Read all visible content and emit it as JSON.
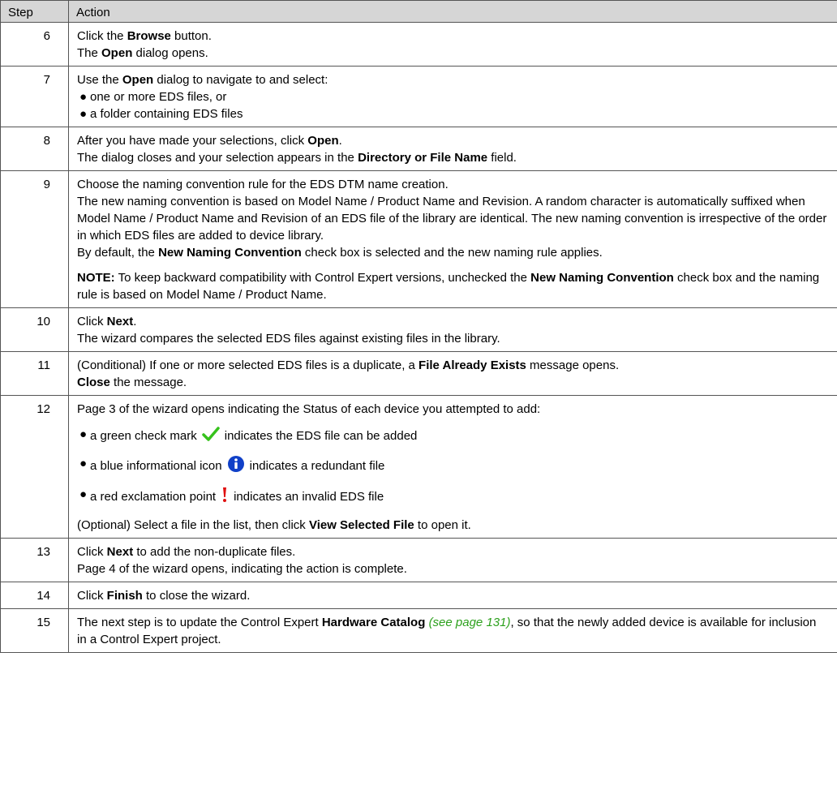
{
  "header": {
    "step": "Step",
    "action": "Action"
  },
  "rows": {
    "r6": {
      "step": "6",
      "l1a": "Click the ",
      "l1b": "Browse",
      "l1c": " button.",
      "l2a": "The ",
      "l2b": "Open",
      "l2c": " dialog opens."
    },
    "r7": {
      "step": "7",
      "l1a": "Use the ",
      "l1b": "Open",
      "l1c": " dialog to navigate to and select:",
      "b1": "one or more EDS files, or",
      "b2": "a folder containing EDS files"
    },
    "r8": {
      "step": "8",
      "l1a": "After you have made your selections, click ",
      "l1b": "Open",
      "l1c": ".",
      "l2a": "The dialog closes and your selection appears in the ",
      "l2b": "Directory or File Name",
      "l2c": " field."
    },
    "r9": {
      "step": "9",
      "l1": "Choose the naming convention rule for the EDS DTM name creation.",
      "l2": "The new naming convention is based on Model Name / Product Name and Revision. A random character is automatically suffixed when Model Name / Product Name and Revision of an EDS file of the library are identical. The new naming convention is irrespective of the order in which EDS files are added to device library.",
      "l3a": "By default, the ",
      "l3b": "New Naming Convention",
      "l3c": " check box is selected and the new naming rule applies.",
      "note_label": "NOTE:",
      "n1": " To keep backward compatibility with Control Expert versions, unchecked the ",
      "n2": "New Naming Convention",
      "n3": " check box and the naming rule is based on Model Name / Product Name."
    },
    "r10": {
      "step": "10",
      "l1a": "Click ",
      "l1b": "Next",
      "l1c": ".",
      "l2": "The wizard compares the selected EDS files against existing files in the library."
    },
    "r11": {
      "step": "11",
      "l1a": "(Conditional) If one or more selected EDS files is a duplicate, a ",
      "l1b": "File Already Exists",
      "l1c": " message opens.",
      "l2a": "Close",
      "l2b": " the message."
    },
    "r12": {
      "step": "12",
      "l1": "Page 3 of the wizard opens indicating the Status of each device you attempted to add:",
      "b1a": "a green check mark",
      "b1b": "indicates the EDS file can be added",
      "b2a": "a blue informational icon",
      "b2b": "indicates a redundant file",
      "b3a": "a red exclamation point",
      "b3b": "indicates an invalid EDS file",
      "l2a": "(Optional) Select a file in the list, then click ",
      "l2b": "View Selected File",
      "l2c": " to open it."
    },
    "r13": {
      "step": "13",
      "l1a": "Click ",
      "l1b": "Next",
      "l1c": " to add the non-duplicate files.",
      "l2": "Page 4 of the wizard opens, indicating the action is complete."
    },
    "r14": {
      "step": "14",
      "l1a": "Click ",
      "l1b": "Finish",
      "l1c": " to close the wizard."
    },
    "r15": {
      "step": "15",
      "l1a": "The next step is to update the Control Expert ",
      "l1b": "Hardware Catalog",
      "link": "(see page 131)",
      "l1c": ", so that the newly added device is available for inclusion in a Control Expert project."
    }
  },
  "bullet": "●",
  "colors": {
    "header_bg": "#d6d6d6",
    "border": "#555555",
    "link": "#2ca01c",
    "check": "#36c21c",
    "info": "#1040c8",
    "error": "#e01010"
  },
  "icons": {
    "check": "check-icon",
    "info": "info-icon",
    "error": "exclamation-icon"
  }
}
